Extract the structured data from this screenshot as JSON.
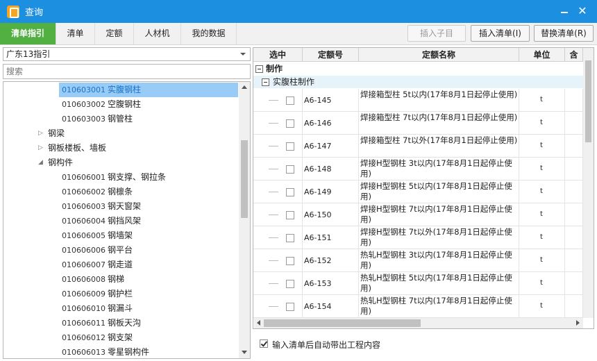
{
  "window": {
    "title": "查询"
  },
  "tabs": [
    {
      "label": "清单指引"
    },
    {
      "label": "清单"
    },
    {
      "label": "定额"
    },
    {
      "label": "人材机"
    },
    {
      "label": "我的数据"
    }
  ],
  "toolbar": {
    "insert_child_label": "插入子目",
    "insert_list_label": "插入清单(I)",
    "replace_list_label": "替换清单(R)"
  },
  "left": {
    "dropdown_value": "广东13指引",
    "search_placeholder": "搜索",
    "tree": [
      {
        "code": "010603001",
        "name": "实腹钢柱",
        "selected": true
      },
      {
        "code": "010603002",
        "name": "空腹钢柱"
      },
      {
        "code": "010603003",
        "name": "钢管柱"
      },
      {
        "group": "钢梁",
        "toggle": "▷"
      },
      {
        "group": "钢板楼板、墙板",
        "toggle": "▷"
      },
      {
        "group": "钢构件",
        "toggle": "◢"
      },
      {
        "code": "010606001",
        "name": "钢支撑、钢拉条"
      },
      {
        "code": "010606002",
        "name": "钢檩条"
      },
      {
        "code": "010606003",
        "name": "钢天窗架"
      },
      {
        "code": "010606004",
        "name": "钢挡风架"
      },
      {
        "code": "010606005",
        "name": "钢墙架"
      },
      {
        "code": "010606006",
        "name": "钢平台"
      },
      {
        "code": "010606007",
        "name": "钢走道"
      },
      {
        "code": "010606008",
        "name": "钢梯"
      },
      {
        "code": "010606009",
        "name": "钢护栏"
      },
      {
        "code": "010606010",
        "name": "钢漏斗"
      },
      {
        "code": "010606011",
        "name": "钢板天沟"
      },
      {
        "code": "010606012",
        "name": "钢支架"
      },
      {
        "code": "010606013",
        "name": "零星钢构件"
      }
    ]
  },
  "grid": {
    "headers": [
      "选中",
      "定额号",
      "定额名称",
      "单位",
      "含"
    ],
    "group1": "制作",
    "group2": "实腹柱制作",
    "rows": [
      {
        "code": "A6-145",
        "name": "焊接箱型柱 5t以内(17年8月1日起停止使用)",
        "unit": "t"
      },
      {
        "code": "A6-146",
        "name": "焊接箱型柱 7t以内(17年8月1日起停止使用)",
        "unit": "t"
      },
      {
        "code": "A6-147",
        "name": "焊接箱型柱 7t以外(17年8月1日起停止使用)",
        "unit": "t"
      },
      {
        "code": "A6-148",
        "name": "焊接H型钢柱 3t以内(17年8月1日起停止使用)",
        "unit": "t"
      },
      {
        "code": "A6-149",
        "name": "焊接H型钢柱 5t以内(17年8月1日起停止使用)",
        "unit": "t"
      },
      {
        "code": "A6-150",
        "name": "焊接H型钢柱 7t以内(17年8月1日起停止使用)",
        "unit": "t"
      },
      {
        "code": "A6-151",
        "name": "焊接H型钢柱 7t以外(17年8月1日起停止使用)",
        "unit": "t"
      },
      {
        "code": "A6-152",
        "name": "热轧H型钢柱 3t以内(17年8月1日起停止使用)",
        "unit": "t"
      },
      {
        "code": "A6-153",
        "name": "热轧H型钢柱 5t以内(17年8月1日起停止使用)",
        "unit": "t"
      },
      {
        "code": "A6-154",
        "name": "热轧H型钢柱 7t以内(17年8月1日起停止使用)",
        "unit": "t"
      }
    ]
  },
  "footer": {
    "auto_bring_label": "输入清单后自动带出工程内容",
    "auto_bring_checked": true
  }
}
